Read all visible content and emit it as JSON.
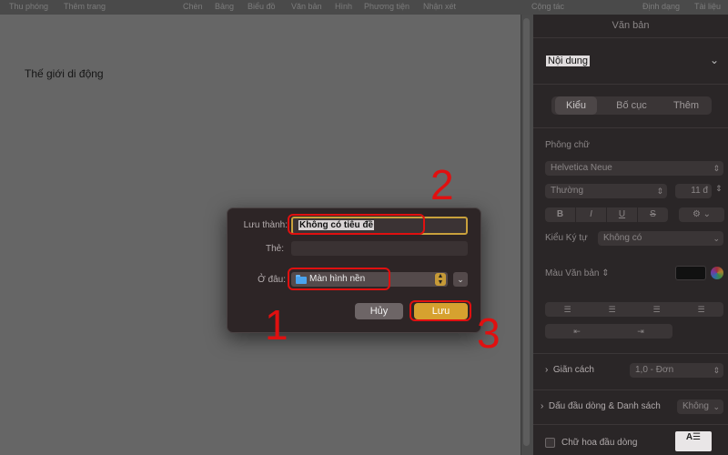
{
  "toolbar": {
    "items": [
      "Thu phóng",
      "Thêm trang",
      "Chèn",
      "Bảng",
      "Biểu đồ",
      "Văn bản",
      "Hình",
      "Phương tiện",
      "Nhận xét",
      "Cộng tác",
      "Định dạng",
      "Tài liệu"
    ]
  },
  "document": {
    "body_text": "Thế giới di động"
  },
  "inspector": {
    "title": "Văn bản",
    "paragraph_style": "Nội dung",
    "tabs": [
      "Kiểu",
      "Bố cục",
      "Thêm"
    ],
    "selected_tab": "Kiểu",
    "font_section_label": "Phông chữ",
    "font_name": "Helvetica Neue",
    "font_style": "Thường",
    "font_size": "11 đ",
    "format_buttons": [
      "B",
      "I",
      "U",
      "S"
    ],
    "char_style_label": "Kiểu Ký tự",
    "char_style_value": "Không có",
    "text_color_label": "Màu Văn bản",
    "spacing_label": "Giãn cách",
    "spacing_value": "1,0 - Đơn",
    "bullets_label": "Dấu đầu dòng & Danh sách",
    "bullets_value": "Không",
    "dropcap_label": "Chữ hoa đầu dòng",
    "colors": {
      "panel_bg": "#2a2627",
      "text_color_swatch": "#111111"
    }
  },
  "save_dialog": {
    "save_as_label": "Lưu thành:",
    "save_as_value": "Không có tiêu đề",
    "tags_label": "Thẻ:",
    "tags_value": "",
    "where_label": "Ở đâu:",
    "where_value": "Màn hình nền",
    "cancel_label": "Hủy",
    "save_label": "Lưu",
    "colors": {
      "accent": "#d6a12f",
      "dialog_bg": "#2d2526"
    }
  },
  "annotations": {
    "steps": [
      "1",
      "2",
      "3"
    ],
    "highlight_color": "#e01010"
  }
}
